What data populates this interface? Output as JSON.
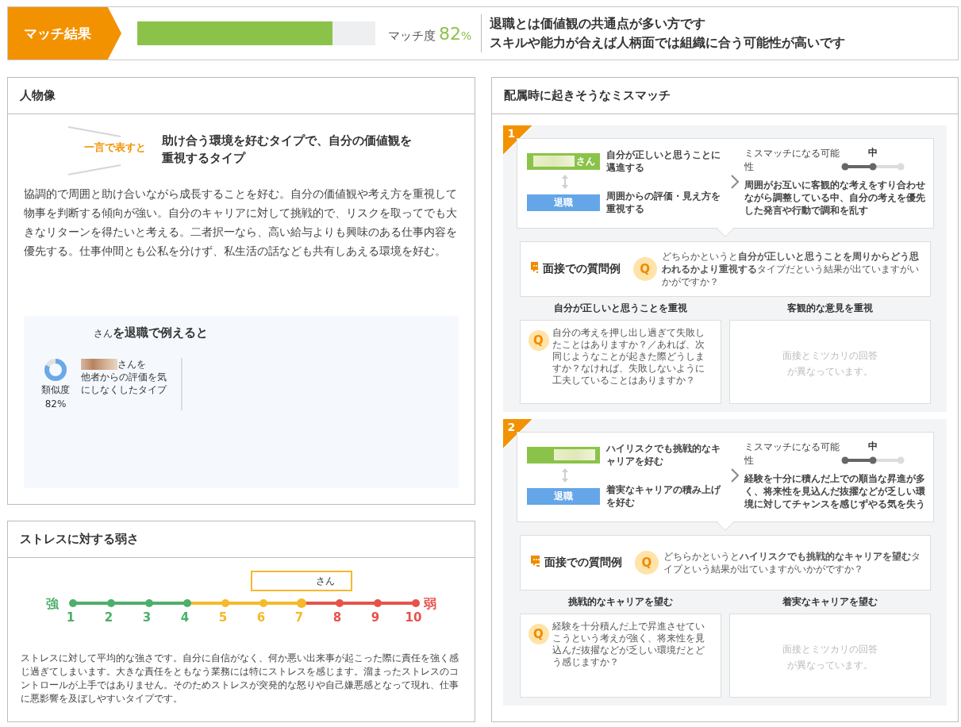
{
  "match": {
    "label": "マッチ結果",
    "level": 0.82,
    "score_label": "マッチ度",
    "score": "82",
    "unit": "%",
    "summary": [
      "退職とは価値観の共通点が多い方です",
      "スキルや能力が合えば人柄面では組織に合う可能性が高いです"
    ]
  },
  "persona": {
    "title": "人物像",
    "lead": "一言で表すと",
    "headline": "助け合う環境を好むタイプで、自分の価値観を重視するタイプ",
    "description": "協調的で周囲と助け合いながら成長することを好む。自分の価値観や考え方を重視して物事を判断する傾向が強い。自分のキャリアに対して挑戦的で、リスクを取ってでも大きなリターンを得たいと考える。二者択一なら、高い給与よりも興味のある仕事内容を優先する。仕事仲間とも公私を分けず、私生活の話なども共有しあえる環境を好む。",
    "example": {
      "title_small": "さん",
      "title": "を退職で例えると",
      "similarity_label": "類似度",
      "similarity": "82%",
      "level": 0.82,
      "name_suffix": "さんを",
      "type": "他者からの評価を気にしなくしたタイプ"
    }
  },
  "stress": {
    "title": "ストレスに対する弱さ",
    "strong": "強",
    "weak": "弱",
    "marker": "さん",
    "points": [
      {
        "label": "1",
        "color": "#4caf6a",
        "selected": false
      },
      {
        "label": "2",
        "color": "#4caf6a",
        "selected": false
      },
      {
        "label": "3",
        "color": "#4caf6a",
        "selected": false
      },
      {
        "label": "4",
        "color": "#4caf6a",
        "selected": false
      },
      {
        "label": "5",
        "color": "#f6b92b",
        "selected": false
      },
      {
        "label": "6",
        "color": "#f6b92b",
        "selected": false
      },
      {
        "label": "7",
        "color": "#f6b92b",
        "selected": true
      },
      {
        "label": "8",
        "color": "#e5534b",
        "selected": false
      },
      {
        "label": "9",
        "color": "#e5534b",
        "selected": false
      },
      {
        "label": "10",
        "color": "#e5534b",
        "selected": false
      }
    ],
    "description": "ストレスに対して平均的な強さです。自分に自信がなく、何か悪い出来事が起こった際に責任を強く感じ過ぎてしまいます。大きな責任をともなう業務には特にストレスを感じます。溜まったストレスのコントロールが上手ではありません。そのためストレスが突発的な怒りや自己嫌悪感となって現れ、仕事に悪影響を及ぼしやすいタイプです。"
  },
  "mismatch": {
    "title": "配属時に起きそうなミスマッチ",
    "items": [
      {
        "number": "1",
        "person_suffix": "さん",
        "person_trait": "自分が正しいと思うことに邁進する",
        "company": "退職",
        "company_trait": "周囲からの評価・見え方を重視する",
        "possibility_label": "ミスマッチになる可能性",
        "level_label": "中",
        "level": 0.5,
        "risk": "周囲がお互いに客観的な考えをすり合わせながら調整している中、自分の考えを優先した発言や行動で調和を乱す",
        "interview_title": "面接での質問例",
        "q_badge": "Q",
        "question": "どちらかというと**自分が正しいと思うことを周りからどう思われるかより重視する**タイプだという結果が出ていますがいかがですか？",
        "answers": [
          {
            "heading": "自分が正しいと思うことを重視",
            "kind": "question",
            "q_badge": "Q",
            "text": "自分の考えを押し出し過ぎて失敗したことはありますか？／あれば、次同じようなことが起きた際どうしますか？なければ、失敗しないように工夫していることはありますか？"
          },
          {
            "heading": "客観的な意見を重視",
            "kind": "empty",
            "text": "面接とミツカリの回答が異なっています。"
          }
        ]
      },
      {
        "number": "2",
        "person_trait": "ハイリスクでも挑戦的なキャリアを好む",
        "company": "退職",
        "company_trait": "着実なキャリアの積み上げを好む",
        "possibility_label": "ミスマッチになる可能性",
        "level_label": "中",
        "level": 0.5,
        "risk": "経験を十分に積んだ上での順当な昇進が多く、将来性を見込んだ抜擢などが乏しい環境に対してチャンスを感じずやる気を失う",
        "interview_title": "面接での質問例",
        "q_badge": "Q",
        "question": "どちらかというと**ハイリスクでも挑戦的なキャリアを望む**タイプという結果が出ていますがいかがですか？",
        "answers": [
          {
            "heading": "挑戦的なキャリアを望む",
            "kind": "question",
            "q_badge": "Q",
            "text": "経験を十分積んだ上で昇進させていこうという考えが強く、将来性を見込んだ抜擢などが乏しい環境だとどう感じますか？"
          },
          {
            "heading": "着実なキャリアを望む",
            "kind": "empty",
            "text": "面接とミツカリの回答が異なっています。"
          }
        ]
      }
    ]
  }
}
